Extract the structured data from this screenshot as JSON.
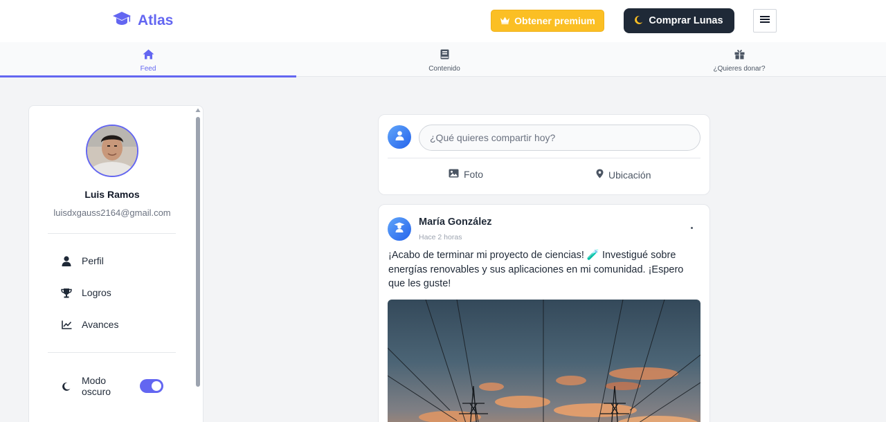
{
  "header": {
    "logo_text": "Atlas",
    "premium_label": "Obtener premium",
    "lunas_label": "Comprar Lunas"
  },
  "tabs": [
    {
      "label": "Feed",
      "icon": "home-icon",
      "active": true
    },
    {
      "label": "Contenido",
      "icon": "book-icon",
      "active": false
    },
    {
      "label": "¿Quieres donar?",
      "icon": "gift-icon",
      "active": false
    }
  ],
  "profile": {
    "name": "Luis Ramos",
    "email": "luisdxgauss2164@gmail.com"
  },
  "sidebar": {
    "items": [
      {
        "label": "Perfil",
        "icon": "user-icon"
      },
      {
        "label": "Logros",
        "icon": "trophy-icon"
      },
      {
        "label": "Avances",
        "icon": "chart-line-icon"
      }
    ],
    "dark_mode_label": "Modo oscuro",
    "dark_mode_on": true
  },
  "composer": {
    "placeholder": "¿Qué quieres compartir hoy?",
    "photo_label": "Foto",
    "location_label": "Ubicación"
  },
  "post": {
    "author": "María González",
    "time": "Hace 2 horas",
    "text": "¡Acabo de terminar mi proyecto de ciencias! 🧪 Investigué sobre energías renovables y sus aplicaciones en mi comunidad. ¡Espero que les guste!"
  },
  "colors": {
    "accent": "#6366f1",
    "premium": "#fbbf24",
    "dark_button": "#1f2937",
    "background": "#f3f4f6"
  }
}
